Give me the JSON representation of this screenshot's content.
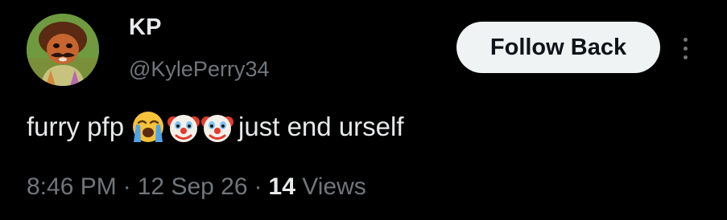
{
  "user": {
    "display_name": "KP",
    "handle": "@KylePerry34"
  },
  "header": {
    "follow_label": "Follow Back"
  },
  "tweet": {
    "text_before": "furry pfp",
    "emojis": [
      "loudly-crying-face-emoji",
      "clown-face-emoji",
      "clown-face-emoji"
    ],
    "text_after": "just end urself"
  },
  "meta": {
    "time": "8:46 PM",
    "separator": "·",
    "date": "12 Sep 26",
    "views_count": "14",
    "views_label": "Views"
  },
  "colors": {
    "background": "#000000",
    "primary_text": "#e7e9ea",
    "secondary_text": "#71767b",
    "button_bg": "#eff3f4",
    "button_text": "#0f1419"
  }
}
